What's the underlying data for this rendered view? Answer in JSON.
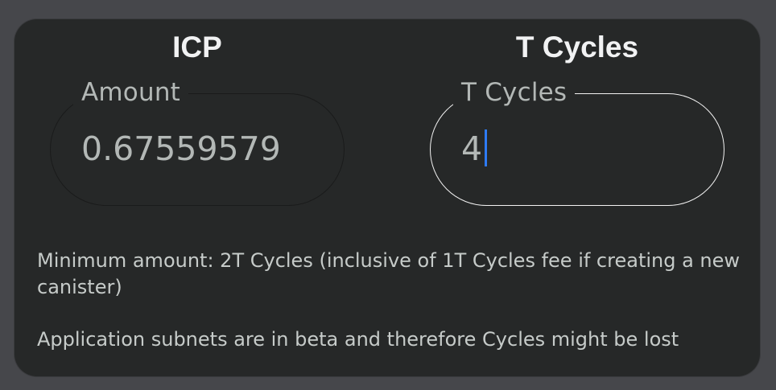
{
  "icp": {
    "title": "ICP",
    "label": "Amount",
    "value": "0.67559579"
  },
  "cycles": {
    "title": "T Cycles",
    "label": "T Cycles",
    "value": "4"
  },
  "notes": {
    "minimum": "Minimum amount: 2T Cycles (inclusive of 1T Cycles fee if creating a new canister)",
    "warning": "Application subnets are in beta and therefore Cycles might be lost"
  },
  "colors": {
    "background": "#46474b",
    "card": "#262828",
    "caret": "#2e7bf6",
    "active_border": "#f2f2f2"
  }
}
